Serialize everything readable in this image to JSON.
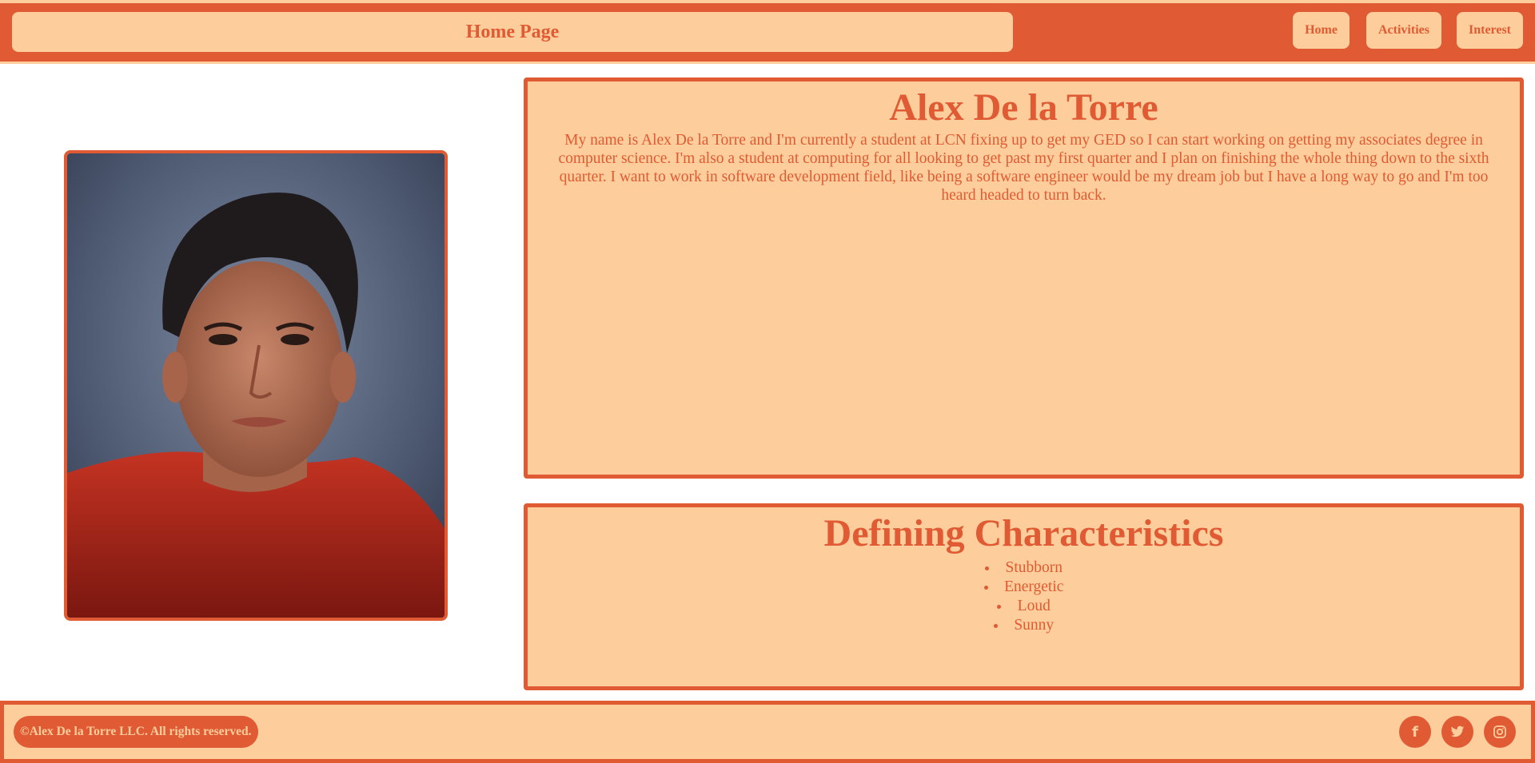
{
  "header": {
    "title": "Home Page",
    "nav": [
      {
        "label": "Home"
      },
      {
        "label": "Activities"
      },
      {
        "label": "Interest"
      }
    ]
  },
  "about": {
    "name": "Alex De la Torre",
    "bio": "My name is Alex De la Torre and I'm currently a student at LCN fixing up to get my GED so I can start working on getting my associates degree in computer science. I'm also a student at computing for all looking to get past my first quarter and I plan on finishing the whole thing down to the sixth quarter. I want to work in software development field, like being a software engineer would be my dream job but I have a long way to go and I'm too heard headed to turn back."
  },
  "traits": {
    "heading": "Defining Characteristics",
    "items": [
      "Stubborn",
      "Energetic",
      "Loud",
      "Sunny"
    ]
  },
  "footer": {
    "copyright": "©Alex De la Torre LLC. All rights reserved.",
    "social": [
      {
        "icon": "facebook-icon",
        "glyph": "f"
      },
      {
        "icon": "twitter-icon",
        "glyph": "🐦"
      },
      {
        "icon": "instagram-icon",
        "glyph": "◎"
      }
    ]
  },
  "colors": {
    "accent": "#e05a34",
    "panel": "#fdce9b",
    "background": "#ffffff"
  }
}
